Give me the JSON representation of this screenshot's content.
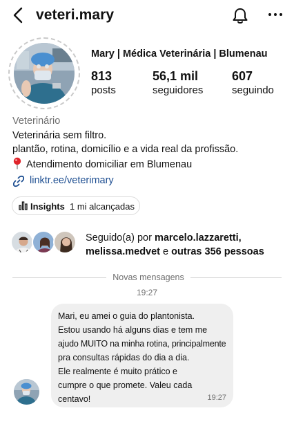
{
  "header": {
    "username": "veteri.mary",
    "icons": [
      "chevron-left-icon",
      "bell-icon",
      "more-icon"
    ]
  },
  "profile": {
    "display_name": "Mary | Médica Veterinária | Blumenau",
    "stats": [
      {
        "value": "813",
        "label": "posts"
      },
      {
        "value": "56,1 mil",
        "label": "seguidores"
      },
      {
        "value": "607",
        "label": "seguindo"
      }
    ],
    "category": "Veterinário",
    "bio_lines": [
      "Veterinária sem filtro.",
      "plantão, rotina, domicílio e a vida real da profissão.",
      "Atendimento domiciliar em Blumenau"
    ],
    "link": "linktr.ee/veterimary"
  },
  "insights": {
    "label": "Insights",
    "value": "1 mi alcançadas"
  },
  "followed_by": {
    "prefix": "Seguido(a) por",
    "user1": "marcelo.lazzaretti,",
    "user2": "melissa.medvet",
    "joiner": "e",
    "rest": "outras 356 pessoas"
  },
  "messages": {
    "divider_label": "Novas mensagens",
    "time_header": "19:27",
    "bubble": {
      "lines": [
        "Mari, eu amei o guia do plantonista.",
        "Estou usando há alguns dias e tem me",
        "ajudo MUITO na minha rotina, principalmente",
        "pra consultas rápidas do dia a dia.",
        "Ele realmente é muito prático e",
        "cumpre o que promete. Valeu cada",
        "centavo!"
      ],
      "time": "19:27"
    }
  },
  "colors": {
    "link": "#1d4e91",
    "muted": "#6e6e6e",
    "bubble": "#efefef",
    "scrub": "#2e6f8e"
  }
}
